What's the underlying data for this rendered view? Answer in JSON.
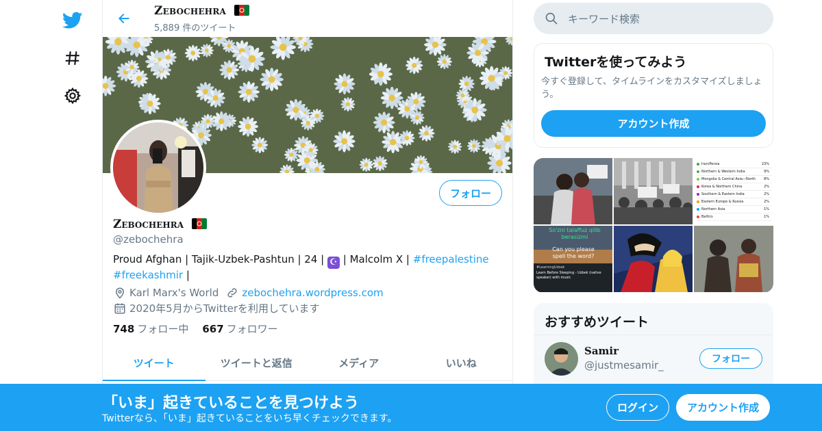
{
  "colors": {
    "accent": "#1da1f2",
    "muted": "#657786",
    "border": "#e6ecf0"
  },
  "leftnav": {
    "icons": [
      "twitter-bird-icon",
      "hashtag-icon",
      "gear-icon"
    ]
  },
  "profile_header": {
    "name": "Zebochehra",
    "tweet_count": "5,889 件のツイート"
  },
  "profile": {
    "display_name": "Zebochehra",
    "handle": "@zebochehra",
    "follow_label": "フォロー",
    "bio": {
      "text1": "Proud Afghan | Tajik-Uzbek-Pashtun | 24 |",
      "moon": "☪",
      "text2": "| Malcolm X |",
      "tag1": "#freepalestine",
      "tag2": "#freekashmir",
      "tail": "|"
    },
    "location": "Karl Marx's World",
    "website": "zebochehra.wordpress.com",
    "joined": "2020年5月からTwitterを利用しています",
    "following_count": "748",
    "following_label": "フォロー中",
    "followers_count": "667",
    "followers_label": "フォロワー"
  },
  "tabs": [
    {
      "label": "ツイート",
      "active": true
    },
    {
      "label": "ツイートと返信",
      "active": false
    },
    {
      "label": "メディア",
      "active": false
    },
    {
      "label": "いいね",
      "active": false
    }
  ],
  "search": {
    "placeholder": "キーワード検索"
  },
  "signup_card": {
    "title": "Twitterを使ってみよう",
    "desc": "今すぐ登録して、タイムラインをカスタマイズしましょう。",
    "button": "アカウント作成"
  },
  "media_grid": {
    "tile3_rows": [
      {
        "label": "Iran/Persia",
        "pct": "23%"
      },
      {
        "label": "Northern & Western India",
        "pct": "9%"
      },
      {
        "label": "Mongolia & Central Asia—North",
        "pct": "8%"
      },
      {
        "label": "Korea & Northern China",
        "pct": "2%"
      },
      {
        "label": "Southern & Eastern India",
        "pct": "2%"
      },
      {
        "label": "Eastern Europe & Russia",
        "pct": "2%"
      },
      {
        "label": "Northern Asia",
        "pct": "1%"
      },
      {
        "label": "Baltics",
        "pct": "1%"
      }
    ],
    "tile4_overlay": "So'zni talaffuz qilib berasizmi",
    "tile4_caption": "Can you please spell the word?",
    "tile4_sub1": "Learn Before Sleeping - Uzbek (native speaker) with music",
    "tile4_meta": "#LearningUzbek"
  },
  "recommended": {
    "title": "おすすめツイート",
    "user_name": "Samir",
    "user_handle": "@justmesamir_",
    "follow_label": "フォロー"
  },
  "bottom_bar": {
    "headline": "「いま」起きていることを見つけよう",
    "sub": "Twitterなら、「いま」起きていることをいち早くチェックできます。",
    "login": "ログイン",
    "signup": "アカウント作成"
  }
}
